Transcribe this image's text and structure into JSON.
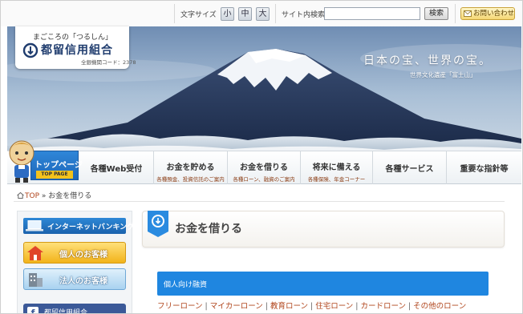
{
  "topbar": {
    "font_size_label": "文字サイズ",
    "font_sizes": [
      "小",
      "中",
      "大"
    ],
    "search_label": "サイト内検索",
    "search_value": "",
    "search_button": "検索",
    "contact_label": "お問い合わせ",
    "contact_icon": "mail-icon"
  },
  "logo": {
    "tagline": "まごころの「つるしん」",
    "name": "都留信用組合",
    "code": "全銀機関コード：2378"
  },
  "hero": {
    "catch": "日本の宝、世界の宝。",
    "sub": "世界文化遺産「富士山」"
  },
  "nav": {
    "top_label": "トップページ",
    "top_sub": "TOP PAGE",
    "items": [
      {
        "main": "各種Web受付",
        "sub": ""
      },
      {
        "main": "お金を貯める",
        "sub": "各種預金、投資信託のご案内"
      },
      {
        "main": "お金を借りる",
        "sub": "各種ローン、融資のご案内"
      },
      {
        "main": "将来に備える",
        "sub": "各種保険、年金コーナー"
      },
      {
        "main": "各種サービス",
        "sub": ""
      },
      {
        "main": "重要な指針等",
        "sub": ""
      }
    ]
  },
  "breadcrumb": {
    "home": "TOP",
    "separator": "»",
    "current": "お金を借りる"
  },
  "sidebar": {
    "internet_banking": "インターネットバンキング",
    "personal": "個人のお客様",
    "corporate": "法人のお客様",
    "facebook": "都留信用組合"
  },
  "main": {
    "title": "お金を借りる",
    "section": "個人向け融資",
    "links": [
      "フリーローン",
      "マイカーローン",
      "教育ローン",
      "住宅ローン",
      "カードローン",
      "その他のローン"
    ],
    "link_separator": "|"
  },
  "colors": {
    "nav_top": "#1e67b8",
    "section_bar": "#1f86e0",
    "link": "#b0441b",
    "gold_button": "#f2b31a"
  }
}
